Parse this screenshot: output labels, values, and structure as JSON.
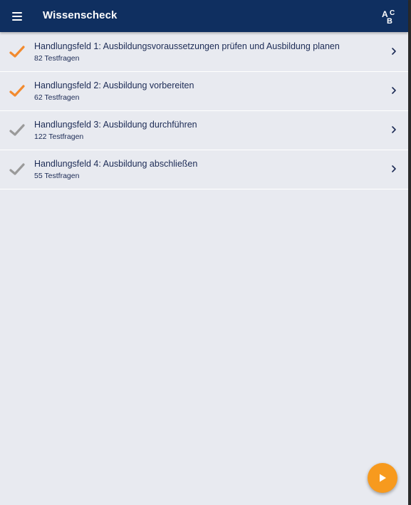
{
  "header": {
    "title": "Wissenscheck",
    "menu_icon": "hamburger-menu-icon",
    "abc_icon": "abc-sort-icon",
    "background_color": "#0f2f60"
  },
  "list": {
    "items": [
      {
        "title": "Handlungsfeld 1: Ausbildungsvoraussetzungen prüfen und Ausbildung planen",
        "subtitle": "82 Testfragen",
        "status": "completed"
      },
      {
        "title": "Handlungsfeld 2: Ausbildung vorbereiten",
        "subtitle": "62 Testfragen",
        "status": "completed"
      },
      {
        "title": "Handlungsfeld 3: Ausbildung durchführen",
        "subtitle": "122 Testfragen",
        "status": "open"
      },
      {
        "title": "Handlungsfeld 4: Ausbildung abschließen",
        "subtitle": "55 Testfragen",
        "status": "open"
      }
    ]
  },
  "colors": {
    "accent": "#f79a1e",
    "check_completed": "#f28a2e",
    "check_open": "#9a9a9a",
    "background": "#e8eaf0",
    "text": "#1c2b55"
  },
  "fab": {
    "icon": "play-icon"
  }
}
